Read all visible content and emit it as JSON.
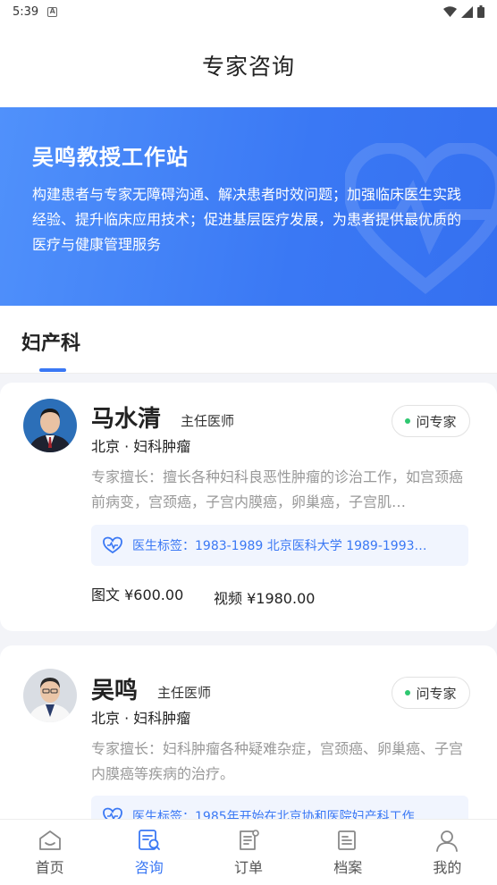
{
  "status_bar": {
    "time": "5:39",
    "notification_icon": "a-icon"
  },
  "header": {
    "title": "专家咨询"
  },
  "banner": {
    "title": "吴鸣教授工作站",
    "description": "构建患者与专家无障碍沟通、解决患者时效问题；加强临床医生实践经验、提升临床应用技术；促进基层医疗发展，为患者提供最优质的医疗与健康管理服务"
  },
  "department": {
    "active_tab": "妇产科"
  },
  "doctors": [
    {
      "name": "马水清",
      "rank": "主任医师",
      "location": "北京 · 妇科肿瘤",
      "ask_label": "问专家",
      "specialty": "专家擅长：擅长各种妇科良恶性肿瘤的诊治工作，如宫颈癌前病变，宫颈癌，子宫内膜癌，卵巢癌，子宫肌…",
      "tag": "医生标签：1983-1989  北京医科大学 1989-1993…",
      "price_text": "图文 ¥600.00",
      "price_video": "视频 ¥1980.00"
    },
    {
      "name": "吴鸣",
      "rank": "主任医师",
      "location": "北京 · 妇科肿瘤",
      "ask_label": "问专家",
      "specialty": "专家擅长：妇科肿瘤各种疑难杂症，宫颈癌、卵巢癌、子宫内膜癌等疾病的治疗。",
      "tag": "医生标签：1985年开始在北京协和医院妇产科工作"
    }
  ],
  "bottom_nav": [
    {
      "label": "首页",
      "icon": "home-icon",
      "active": false
    },
    {
      "label": "咨询",
      "icon": "consult-icon",
      "active": true
    },
    {
      "label": "订单",
      "icon": "order-icon",
      "active": false
    },
    {
      "label": "档案",
      "icon": "archive-icon",
      "active": false
    },
    {
      "label": "我的",
      "icon": "profile-icon",
      "active": false
    }
  ],
  "colors": {
    "accent": "#3a78f4",
    "online_dot": "#2ec770",
    "banner_start": "#5091fb",
    "banner_end": "#3570f0"
  }
}
